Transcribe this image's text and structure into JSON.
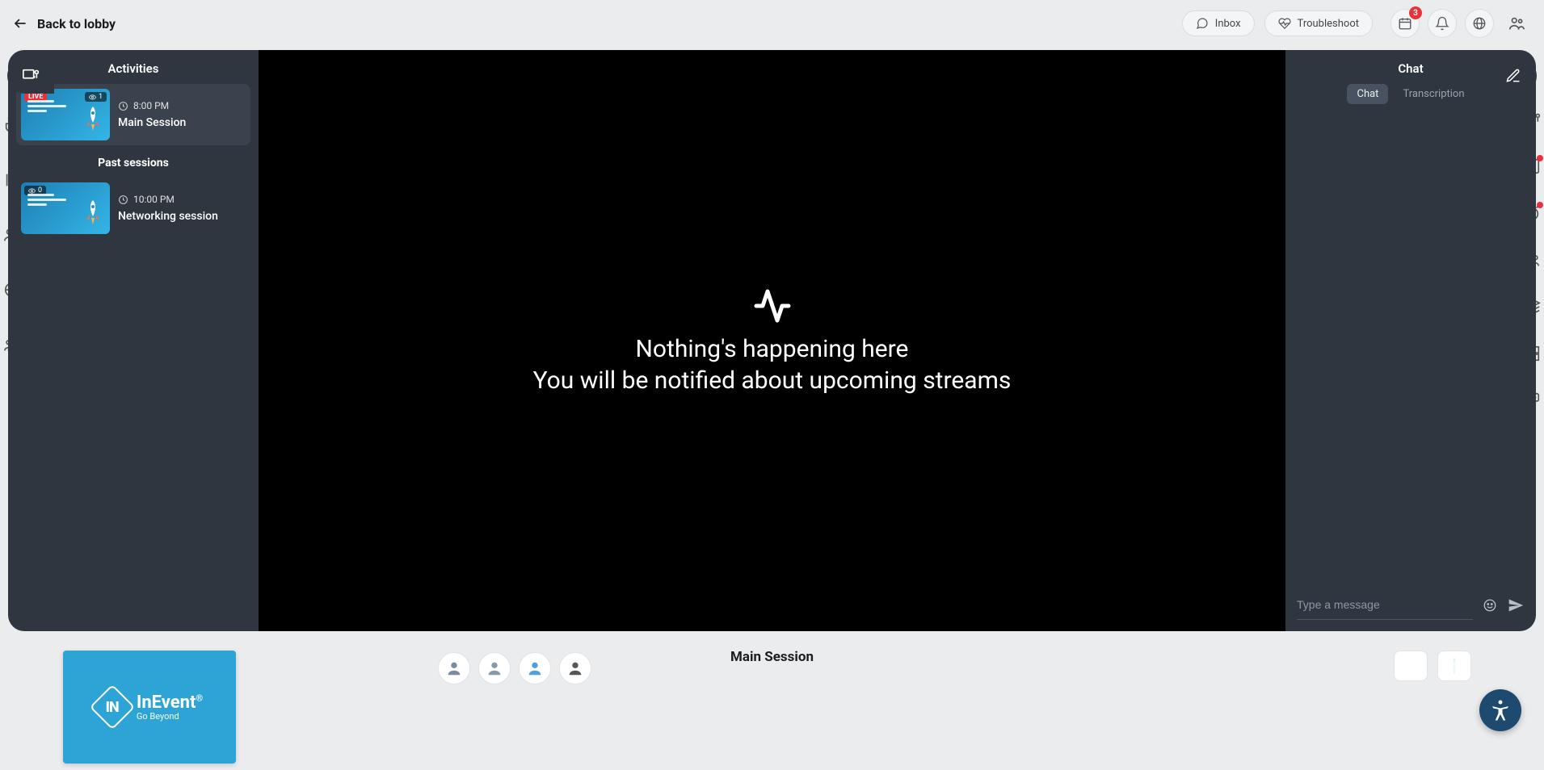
{
  "header": {
    "back_label": "Back to lobby",
    "inbox_label": "Inbox",
    "troubleshoot_label": "Troubleshoot",
    "notif_count": "3"
  },
  "activities": {
    "title": "Activities",
    "live_session": {
      "badge": "LIVE",
      "viewers": "1",
      "time": "8:00 PM",
      "title": "Main Session"
    },
    "past_label": "Past sessions",
    "past_session": {
      "viewers": "0",
      "time": "10:00 PM",
      "title": "Networking session"
    }
  },
  "video": {
    "line1": "Nothing's happening here",
    "line2": "You will be notified about upcoming streams"
  },
  "chat": {
    "title": "Chat",
    "tab_chat": "Chat",
    "tab_transcription": "Transcription",
    "placeholder": "Type a message"
  },
  "footer": {
    "brand": "InEvent",
    "reg": "®",
    "tagline": "Go Beyond",
    "session_title": "Main Session"
  }
}
